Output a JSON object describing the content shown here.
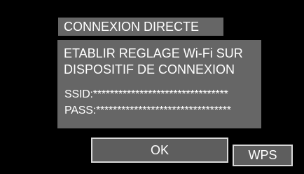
{
  "dialog": {
    "title": "CONNEXION DIRECTE",
    "message_line1": "ETABLIR REGLAGE Wi-Fi SUR",
    "message_line2": "DISPOSITIF DE CONNEXION",
    "ssid_text": "SSID:********************************",
    "pass_text": "PASS:********************************"
  },
  "buttons": {
    "ok_label": "OK",
    "wps_label": "WPS"
  },
  "colors": {
    "background": "#000000",
    "panel": "#666666",
    "button_fill": "#5e5e5e",
    "button_border": "#d8d8d8",
    "text": "#ffffff"
  }
}
